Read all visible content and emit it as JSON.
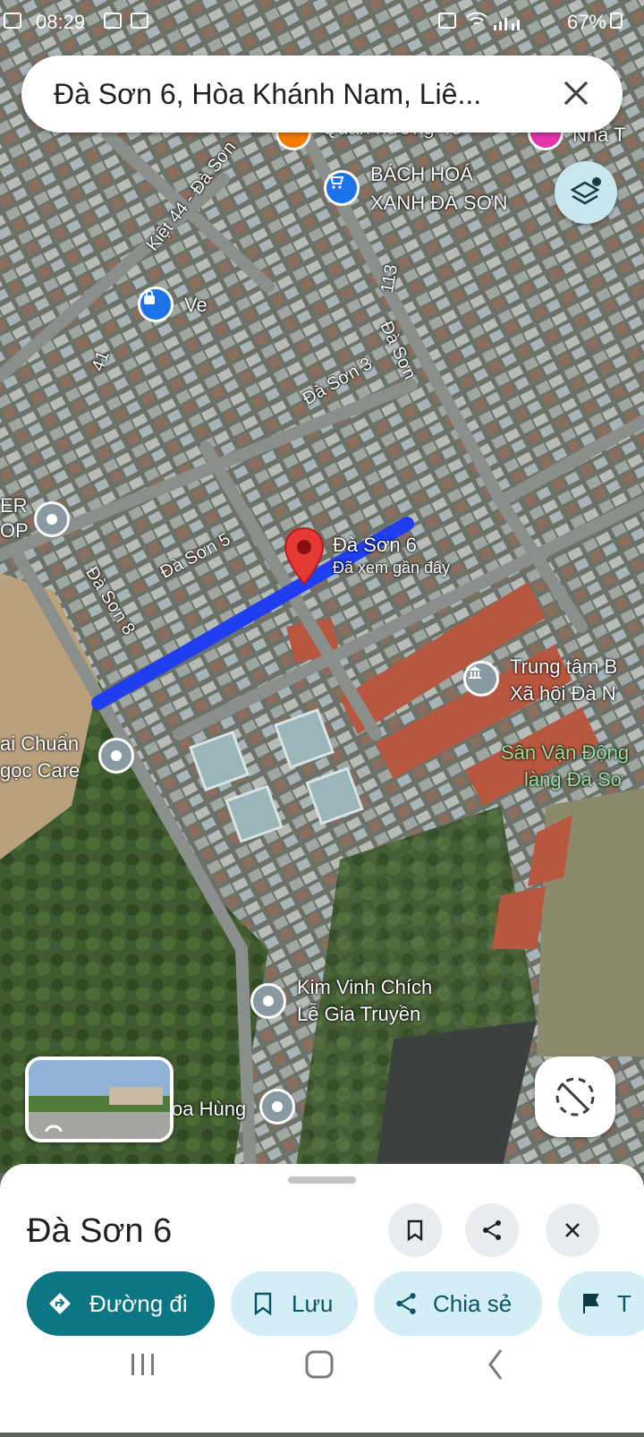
{
  "status_bar": {
    "time": "08:29",
    "battery": "67%"
  },
  "search": {
    "query": "Đà Sơn 6, Hòa Khánh Nam, Liê..."
  },
  "map": {
    "road_labels": [
      "Kiệt 44 - Đà Sơn",
      "113",
      "Đà Sơn",
      "Đà Sơn 3",
      "41",
      "Đà Sơn 5",
      "Đà Sơn 8"
    ],
    "selected_place": {
      "name": "Đà Sơn 6",
      "subtitle": "Đã xem gần đây"
    },
    "pois": [
      {
        "name": "BÁCH HOÁ\nXANH ĐÀ SƠN",
        "line1": "BÁCH HOÁ",
        "line2": "XANH ĐÀ SƠN",
        "icon": "shopping-cart-icon",
        "color": "#1a73e8"
      },
      {
        "name": "Ve",
        "icon": "shopping-bag-icon",
        "color": "#1a73e8"
      },
      {
        "line1": "ER",
        "line2": "OP",
        "icon": "pin-icon",
        "color": "#8a9aa3"
      },
      {
        "line1": "Trung tâm B",
        "line2": "Xã hội Đà N",
        "icon": "government-icon",
        "color": "#8a9aa3"
      },
      {
        "line1": "Sân Vận Động",
        "line2": "làng Đà Sơ",
        "icon": "park-icon",
        "color": "#1e8e3e"
      },
      {
        "line1": "ai Chuẩn",
        "line2": "gọc Care",
        "icon": "pin-icon",
        "color": "#8a9aa3"
      },
      {
        "line1": "Kim Vinh Chích",
        "line2": "Lễ Gia Truyền",
        "icon": "pin-icon",
        "color": "#8a9aa3"
      },
      {
        "line1": "oa Hùng",
        "icon": "pin-icon",
        "color": "#8a9aa3"
      },
      {
        "line1": "Nhà T",
        "icon": "pin-icon",
        "color": "#e535ab"
      },
      {
        "line1": "Quán nướng 45",
        "icon": "restaurant-icon",
        "color": "#f57c00"
      }
    ]
  },
  "sheet": {
    "title": "Đà Sơn 6",
    "actions": {
      "directions": "Đường đi",
      "save": "Lưu",
      "share": "Chia sẻ",
      "more": "T"
    }
  },
  "colors": {
    "accent": "#0b7784",
    "chip_bg": "#d4eef6",
    "route": "#1f3ef0",
    "pin": "#e53935"
  }
}
